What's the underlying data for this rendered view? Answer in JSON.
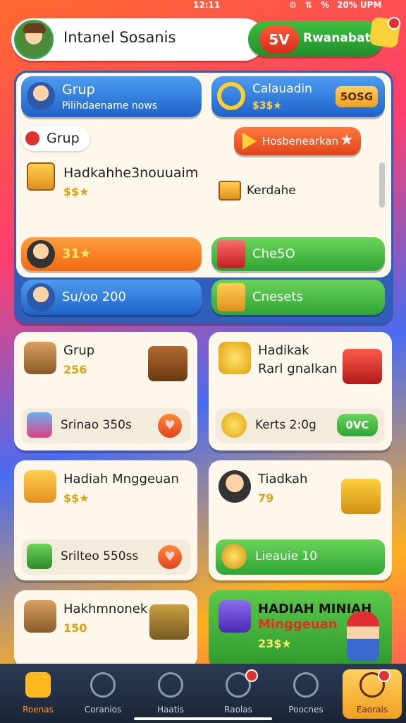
{
  "status_bar": {
    "time": "12:11",
    "icons": "⚙ ⇅ %",
    "battery": "20% UPM"
  },
  "header": {
    "profile_name": "Intanel Sosanis",
    "rank_badge": "5V",
    "rank_label": "Rwanabat"
  },
  "panel": {
    "top_left": {
      "title": "Grup",
      "subtitle": "Pilihdaename nows"
    },
    "top_right": {
      "title": "Calauadin",
      "value": "$3$★",
      "badge": "5OSG"
    },
    "group_tag": "Grup",
    "play_button": "Hosbenearkan",
    "gift_row": {
      "title": "Hadkahhe3nouuaim",
      "price": "$$★",
      "sub_label": "Kerdahe"
    },
    "mid_left": {
      "value": "31★"
    },
    "mid_right": {
      "value": "Che5O"
    },
    "bottom_left": {
      "value": "Su/oo 200"
    },
    "bottom_right": {
      "value": "Cnesets"
    }
  },
  "cards": [
    {
      "title": "Grup",
      "coins": "256",
      "footer": "Srinao 350s"
    },
    {
      "title": "Hadikak",
      "subtitle": "Rarl gnalkan",
      "footer": "Kerts 2:0g",
      "pill": "0VC"
    },
    {
      "title": "Hadiah Mnggeuan",
      "coins": "$$★",
      "footer": "Srilteo 550ss"
    },
    {
      "title": "Tiadkah",
      "coins": "79",
      "footer": "Lieauie 10"
    },
    {
      "title": "Hakhmnonek",
      "coins": "150"
    },
    {
      "title": "HADIAH MINIAH",
      "subtitle": "Minggeuan",
      "coins": "23$★"
    }
  ],
  "nav": [
    {
      "label": "Roenas"
    },
    {
      "label": "Coranios"
    },
    {
      "label": "Haatis"
    },
    {
      "label": "Raolas"
    },
    {
      "label": "Poocnes"
    },
    {
      "label": "Eaorals"
    }
  ]
}
